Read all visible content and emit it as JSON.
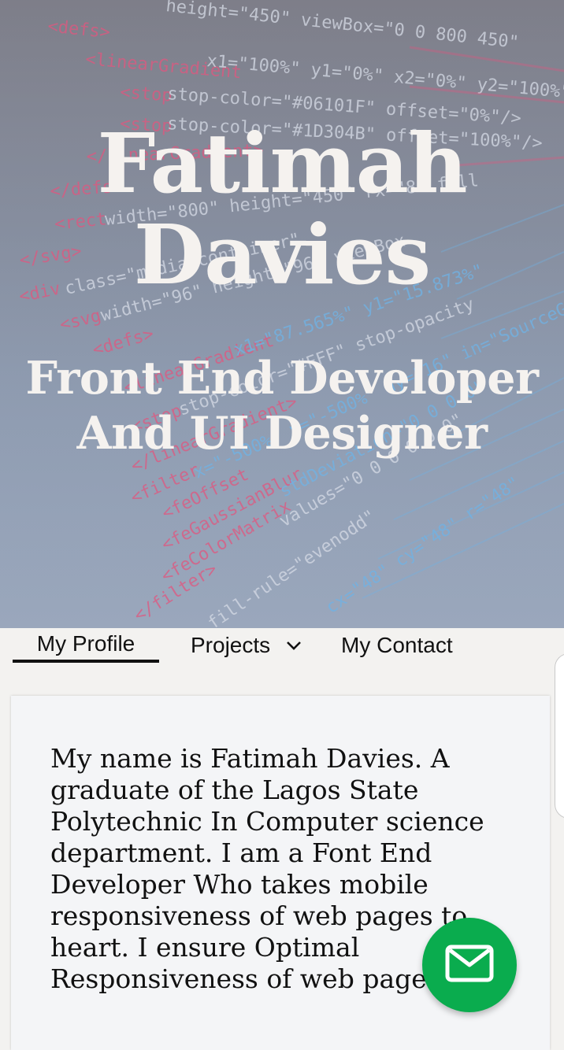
{
  "hero": {
    "name_line1": "Fatimah",
    "name_line2": "Davies",
    "role_line1": "Front End Developer",
    "role_line2": "And UI Designer"
  },
  "nav": {
    "items": [
      {
        "label": "My Profile",
        "active": true
      },
      {
        "label": "Projects",
        "has_dropdown": true,
        "icon": "chevron-down-icon"
      },
      {
        "label": "My Contact"
      }
    ]
  },
  "profile": {
    "bio": "My name is Fatimah Davies. A graduate of the Lagos State Polytechnic In Computer science department. I am a Font End Developer Who takes mobile responsiveness of web pages to heart. I ensure Optimal Responsiveness of web pages"
  },
  "fab": {
    "icon": "mail-icon",
    "color": "#0aac4e"
  },
  "colors": {
    "hero_text": "#f5f2ef",
    "page_bg": "#f3f2f0",
    "card_bg": "#f4f5f7",
    "accent_green": "#0aac4e"
  }
}
